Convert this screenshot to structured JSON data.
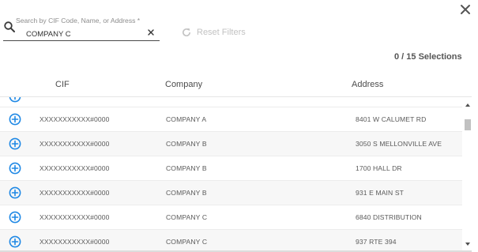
{
  "dialog": {
    "close_icon": "close-icon"
  },
  "search": {
    "label": "Search by CIF Code, Name, or Address *",
    "value": "COMPANY C",
    "search_icon": "search-icon",
    "clear_icon": "clear-icon"
  },
  "reset_filters": {
    "label": "Reset Filters",
    "icon": "refresh-icon",
    "enabled": false
  },
  "selections": {
    "text": "0 / 15 Selections"
  },
  "table": {
    "headers": {
      "cif": "CIF",
      "company": "Company",
      "address": "Address"
    },
    "row_icon": "add-circle-icon",
    "rows": [
      {
        "cif": "XXXXXXXXXXX#0000",
        "company": "COMPANY A",
        "address": "8401 W CALUMET RD"
      },
      {
        "cif": "XXXXXXXXXXX#0000",
        "company": "COMPANY B",
        "address": "3050 S MELLONVILLE AVE"
      },
      {
        "cif": "XXXXXXXXXXX#0000",
        "company": "COMPANY B",
        "address": "1700 HALL DR"
      },
      {
        "cif": "XXXXXXXXXXX#0000",
        "company": "COMPANY B",
        "address": "931 E MAIN ST"
      },
      {
        "cif": "XXXXXXXXXXX#0000",
        "company": "COMPANY C",
        "address": "6840 DISTRIBUTION"
      },
      {
        "cif": "XXXXXXXXXXX#0000",
        "company": "COMPANY C",
        "address": "937 RTE 394"
      }
    ]
  },
  "colors": {
    "accent": "#1e88e5",
    "disabled_text": "#c2c2c2",
    "text": "#4a4a4a"
  }
}
